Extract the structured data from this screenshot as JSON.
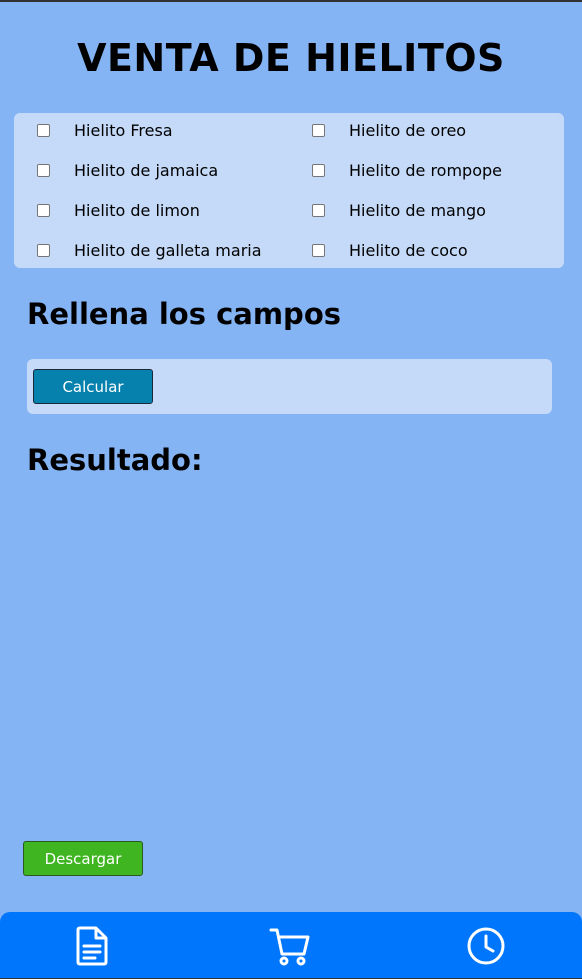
{
  "header": {
    "title": "VENTA DE HIELITOS"
  },
  "flavors": [
    {
      "label": "Hielito Fresa",
      "checked": false
    },
    {
      "label": "Hielito de oreo",
      "checked": false
    },
    {
      "label": "Hielito de jamaica",
      "checked": false
    },
    {
      "label": "Hielito de rompope",
      "checked": false
    },
    {
      "label": "Hielito de limon",
      "checked": false
    },
    {
      "label": "Hielito de mango",
      "checked": false
    },
    {
      "label": "Hielito de galleta maria",
      "checked": false
    },
    {
      "label": "Hielito de coco",
      "checked": false
    }
  ],
  "form": {
    "heading": "Rellena los campos",
    "calculate_label": "Calcular"
  },
  "result": {
    "heading": "Resultado:"
  },
  "actions": {
    "download_label": "Descargar"
  },
  "navbar": {
    "items": [
      {
        "icon": "document-icon"
      },
      {
        "icon": "cart-icon"
      },
      {
        "icon": "clock-icon"
      }
    ]
  },
  "colors": {
    "background": "#84b4f4",
    "panel": "#c5daf9",
    "calculate_button": "#0680ad",
    "download_button": "#3fb521",
    "navbar": "#0076fc"
  }
}
